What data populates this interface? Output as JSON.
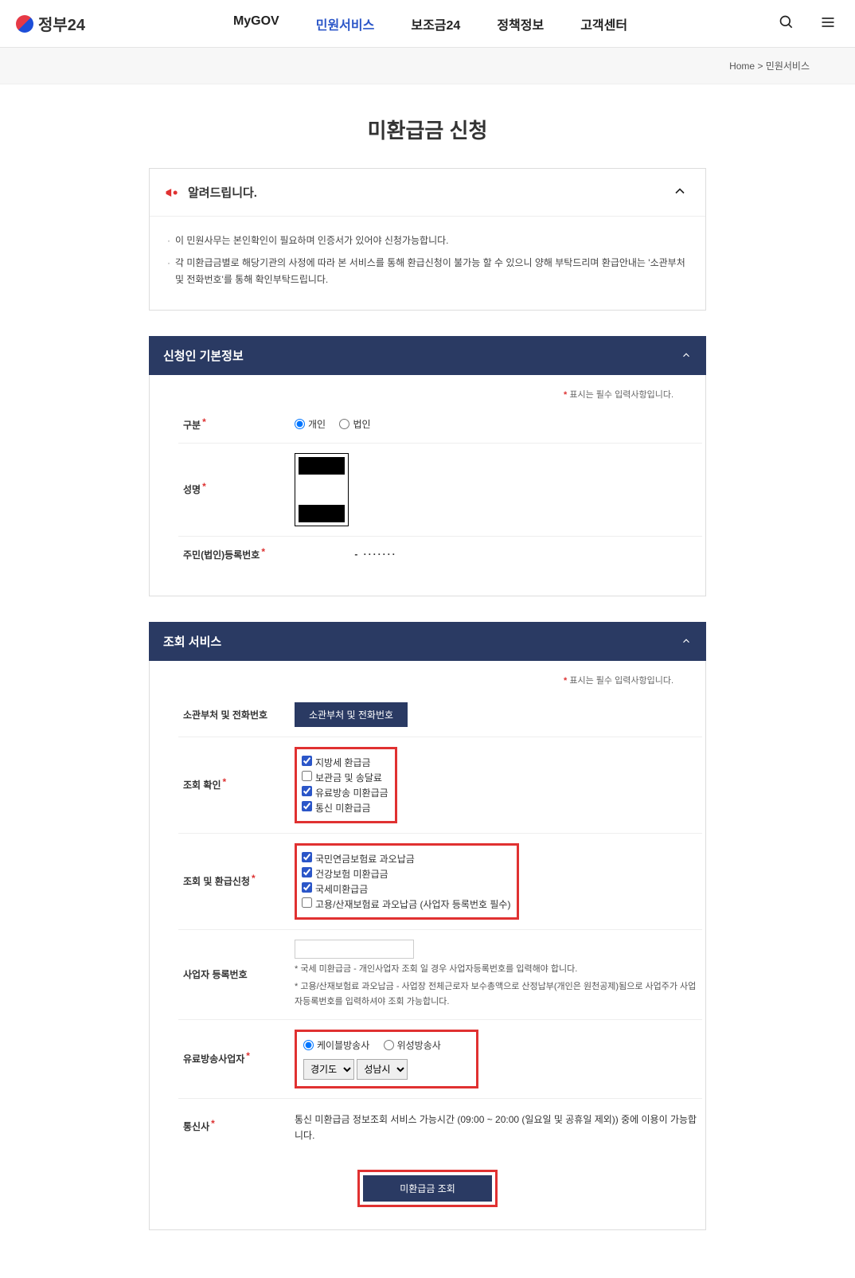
{
  "header": {
    "logo_text": "정부24",
    "nav": {
      "mygov": "MyGOV",
      "civil": "민원서비스",
      "subsidy": "보조금24",
      "policy": "정책정보",
      "support": "고객센터"
    }
  },
  "breadcrumb": {
    "home": "Home",
    "sep": ">",
    "current": "민원서비스"
  },
  "page_title": "미환급금 신청",
  "notice": {
    "title": "알려드립니다.",
    "items": [
      "이 민원사무는 본인확인이 필요하며 인증서가 있어야 신청가능합니다.",
      "각 미환급금별로 해당기관의 사정에 따라 본 서비스를 통해 환급신청이 불가능 할 수 있으니 양해 부탁드리며 환급안내는 '소관부처 및 전화번호'를 통해 확인부탁드립니다."
    ]
  },
  "sec1": {
    "title": "신청인 기본정보",
    "req_note": "표시는 필수 입력사항입니다.",
    "row_type_label": "구분",
    "type_individual": "개인",
    "type_corporate": "법인",
    "row_name_label": "성명",
    "row_rrn_label": "주민(법인)등록번호",
    "rrn_mask": "-  ·······"
  },
  "sec2": {
    "title": "조회 서비스",
    "req_note": "표시는 필수 입력사항입니다.",
    "row_dept_label": "소관부처 및 전화번호",
    "dept_btn": "소관부처 및 전화번호",
    "row_check_label": "조회 확인",
    "check_items": {
      "a": "지방세 환급금",
      "b": "보관금 및 송달료",
      "c": "유료방송 미환급금",
      "d": "통신 미환급금"
    },
    "row_apply_label": "조회 및 환급신청",
    "apply_items": {
      "a": "국민연금보험료 과오납금",
      "b": "건강보험 미환급금",
      "c": "국세미환급금",
      "d": "고용/산재보험료 과오납금 (사업자 등록번호 필수)"
    },
    "row_biz_label": "사업자 등록번호",
    "biz_note1": "* 국세 미환급금 - 개인사업자 조회 일 경우 사업자등록번호를 입력해야 합니다.",
    "biz_note2": "* 고용/산재보험료 과오납금 - 사업장 전체근로자 보수총액으로 산정납부(개인은 원천공제)됨으로 사업주가 사업자등록번호를 입력하셔야 조회 가능합니다.",
    "row_broadcast_label": "유료방송사업자",
    "broadcast_cable": "케이블방송사",
    "broadcast_sat": "위성방송사",
    "region1": "경기도",
    "region2": "성남시",
    "row_telecom_label": "통신사",
    "telecom_note": "통신 미환급금 정보조회 서비스 가능시간 (09:00 ~ 20:00 (일요일 및 공휴일 제외)) 중에 이용이 가능합니다.",
    "submit_btn": "미환급금 조회"
  }
}
